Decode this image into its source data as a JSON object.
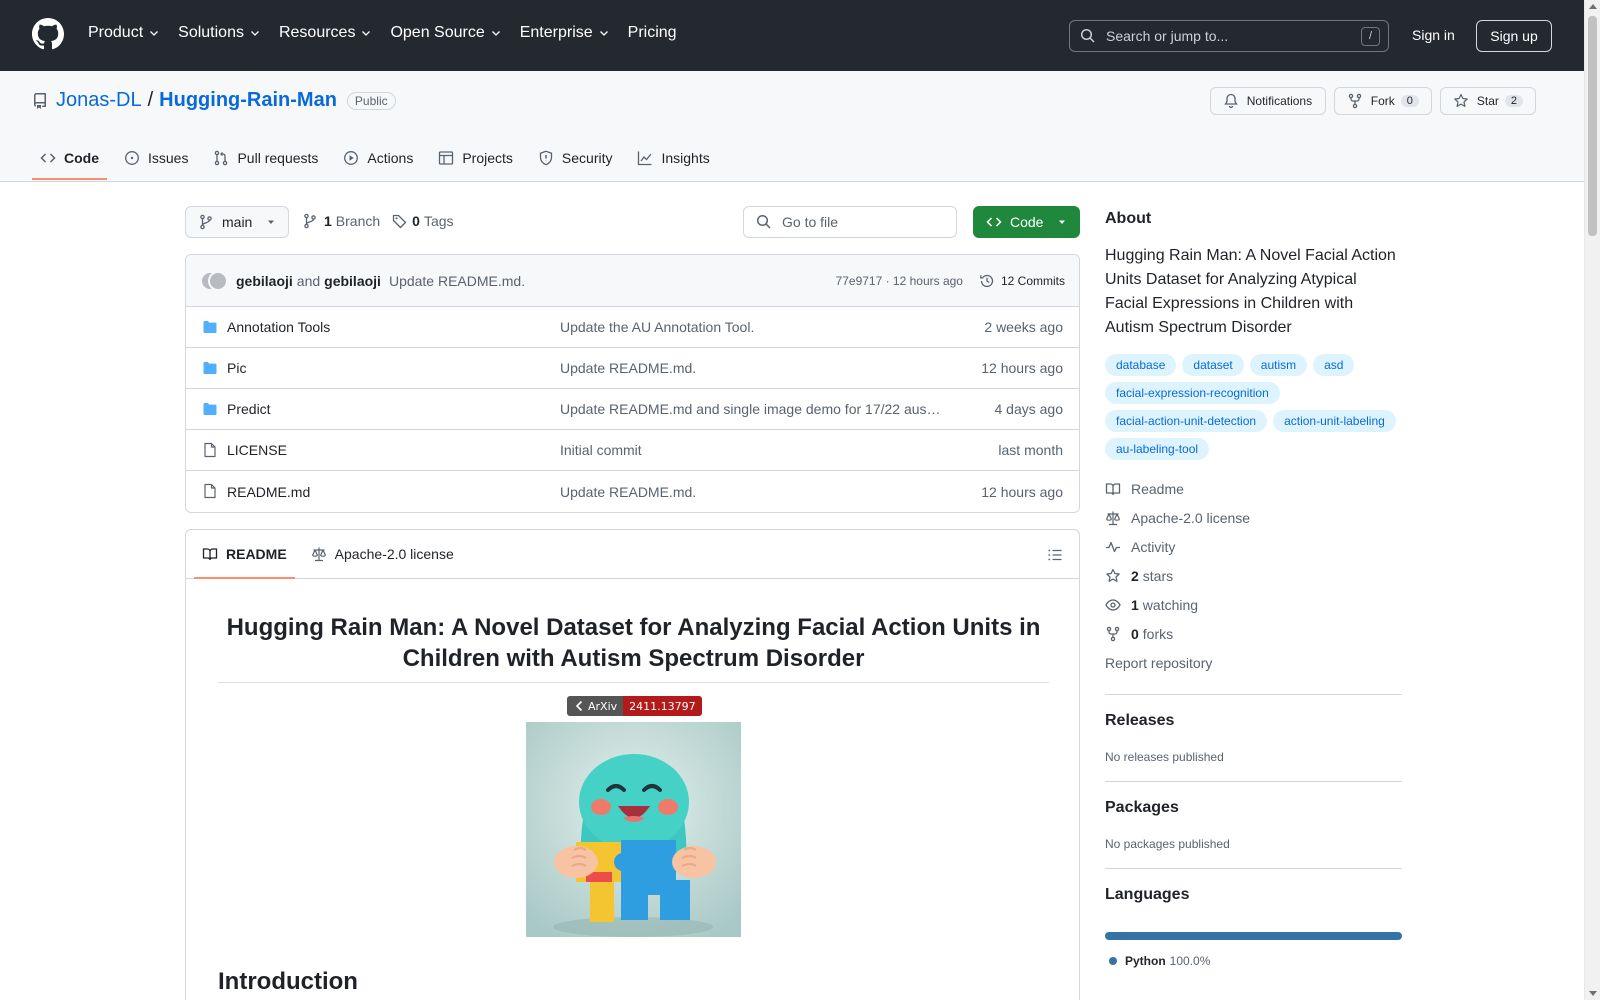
{
  "header": {
    "nav": [
      {
        "label": "Product",
        "dropdown": true
      },
      {
        "label": "Solutions",
        "dropdown": true
      },
      {
        "label": "Resources",
        "dropdown": true
      },
      {
        "label": "Open Source",
        "dropdown": true
      },
      {
        "label": "Enterprise",
        "dropdown": true
      },
      {
        "label": "Pricing",
        "dropdown": false
      }
    ],
    "search_placeholder": "Search or jump to...",
    "search_shortcut": "/",
    "sign_in": "Sign in",
    "sign_up": "Sign up"
  },
  "repo": {
    "owner": "Jonas-DL",
    "separator": "/",
    "name": "Hugging-Rain-Man",
    "visibility": "Public",
    "notifications_label": "Notifications",
    "fork_label": "Fork",
    "fork_count": "0",
    "star_label": "Star",
    "star_count": "2",
    "tabs": [
      {
        "label": "Code",
        "icon": "code-icon",
        "active": true
      },
      {
        "label": "Issues",
        "icon": "issue-icon"
      },
      {
        "label": "Pull requests",
        "icon": "pull-request-icon"
      },
      {
        "label": "Actions",
        "icon": "play-icon"
      },
      {
        "label": "Projects",
        "icon": "table-icon"
      },
      {
        "label": "Security",
        "icon": "shield-icon"
      },
      {
        "label": "Insights",
        "icon": "graph-icon"
      }
    ]
  },
  "toolbar": {
    "branch": "main",
    "branch_count": "1",
    "branch_label": "Branch",
    "tag_count": "0",
    "tag_label": "Tags",
    "goto_placeholder": "Go to file",
    "code_label": "Code"
  },
  "commit": {
    "author1": "gebilaoji",
    "and_text": "and",
    "author2": "gebilaoji",
    "message": "Update README.md.",
    "hash_time": "77e9717 · 12 hours ago",
    "commits_label": "12 Commits"
  },
  "files": [
    {
      "name": "Annotation Tools",
      "type": "folder",
      "message": "Update the AU Annotation Tool.",
      "date": "2 weeks ago"
    },
    {
      "name": "Pic",
      "type": "folder",
      "message": "Update README.md.",
      "date": "12 hours ago"
    },
    {
      "name": "Predict",
      "type": "folder",
      "message": "Update README.md and single image demo for 17/22 aus…",
      "date": "4 days ago"
    },
    {
      "name": "LICENSE",
      "type": "file",
      "message": "Initial commit",
      "date": "last month"
    },
    {
      "name": "README.md",
      "type": "file",
      "message": "Update README.md.",
      "date": "12 hours ago"
    }
  ],
  "readme": {
    "tab_readme": "README",
    "tab_license": "Apache-2.0 license",
    "title": "Hugging Rain Man: A Novel Dataset for Analyzing Facial Action Units in Children with Autism Spectrum Disorder",
    "badge_left": "ArXiv",
    "badge_right": "2411.13797",
    "intro_heading": "Introduction"
  },
  "about": {
    "heading": "About",
    "description": "Hugging Rain Man: A Novel Facial Action Units Dataset for Analyzing Atypical Facial Expressions in Children with Autism Spectrum Disorder",
    "topics": [
      "database",
      "dataset",
      "autism",
      "asd",
      "facial-expression-recognition",
      "facial-action-unit-detection",
      "action-unit-labeling",
      "au-labeling-tool"
    ],
    "readme_link": "Readme",
    "license_link": "Apache-2.0 license",
    "activity_link": "Activity",
    "stars_count": "2",
    "stars_label": "stars",
    "watching_count": "1",
    "watching_label": "watching",
    "forks_count": "0",
    "forks_label": "forks",
    "report_link": "Report repository"
  },
  "releases": {
    "heading": "Releases",
    "empty": "No releases published"
  },
  "packages": {
    "heading": "Packages",
    "empty": "No packages published"
  },
  "languages": {
    "heading": "Languages",
    "items": [
      {
        "name": "Python",
        "percent": "100.0%",
        "fraction": 1.0,
        "color": "#3572a5"
      }
    ]
  },
  "colors": {
    "accent": "#0969da",
    "header_bg": "#24292f",
    "code_button": "#1f883d",
    "tab_underline": "#fd8c73"
  }
}
